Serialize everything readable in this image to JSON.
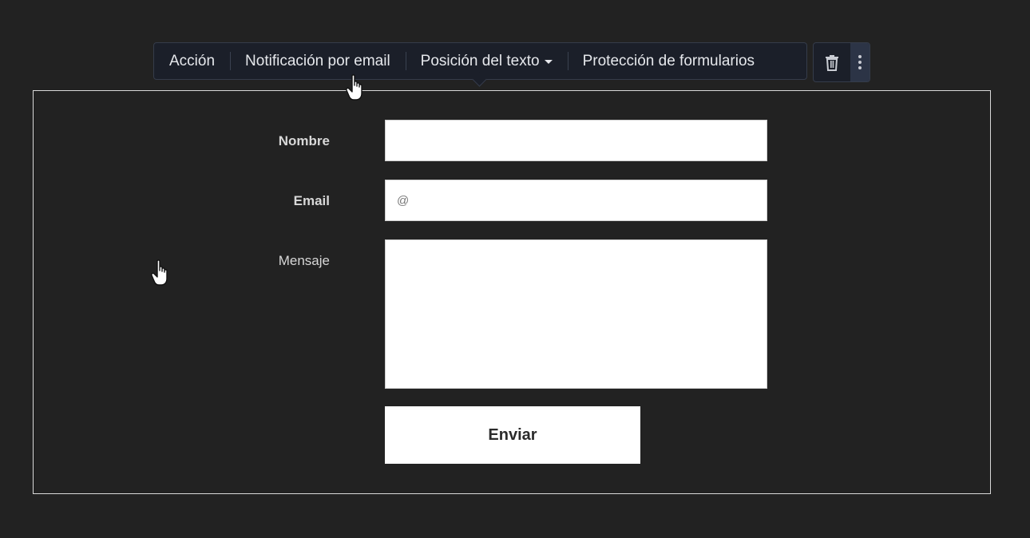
{
  "toolbar": {
    "items": [
      {
        "label": "Acción"
      },
      {
        "label": "Notificación por email"
      },
      {
        "label": "Posición del texto",
        "has_dropdown": true
      },
      {
        "label": "Protección de formularios"
      }
    ],
    "icons": {
      "delete": "trash-icon",
      "more": "more-vertical-icon"
    }
  },
  "form": {
    "fields": [
      {
        "label": "Nombre",
        "value": "",
        "placeholder": ""
      },
      {
        "label": "Email",
        "value": "",
        "placeholder": "@"
      },
      {
        "label": "Mensaje",
        "value": "",
        "placeholder": ""
      }
    ],
    "submit_label": "Enviar"
  },
  "colors": {
    "background": "#222222",
    "toolbar_bg": "#1b1f29",
    "toolbar_text": "#e6e8ec",
    "input_bg": "#ffffff",
    "frame_border": "#d9d9d9"
  }
}
